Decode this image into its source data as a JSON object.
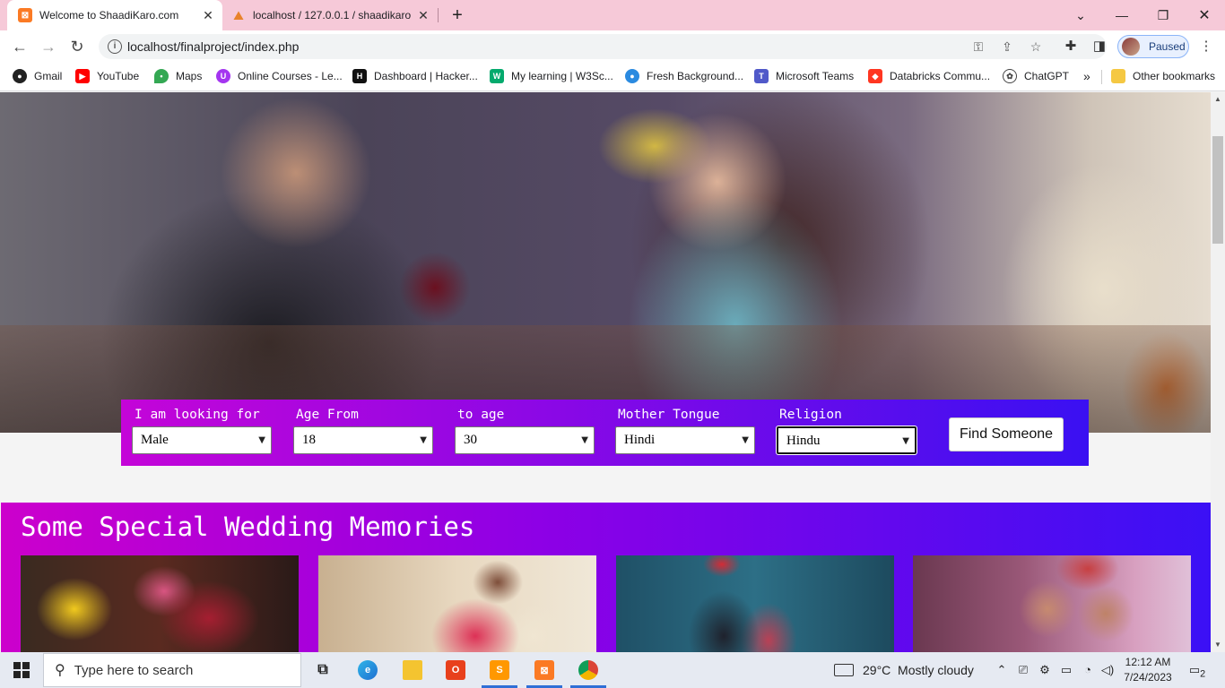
{
  "browser": {
    "tabs": [
      {
        "title": "Welcome to ShaadiKaro.com",
        "icon": "xampp-icon"
      },
      {
        "title": "localhost / 127.0.0.1 / shaadikaro",
        "icon": "phpmyadmin-icon"
      }
    ],
    "url": "localhost/finalproject/index.php",
    "profile_status": "Paused",
    "bookmarks": [
      "Gmail",
      "YouTube",
      "Maps",
      "Online Courses - Le...",
      "Dashboard | Hacker...",
      "My learning | W3Sc...",
      "Fresh Background...",
      "Microsoft Teams",
      "Databricks Commu...",
      "ChatGPT"
    ],
    "bookmarks_overflow": "»",
    "other_bookmarks": "Other bookmarks"
  },
  "search": {
    "looking_for": {
      "label": "I am looking for",
      "value": "Male"
    },
    "age_from": {
      "label": "Age From",
      "value": "18"
    },
    "to_age": {
      "label": "to age",
      "value": "30"
    },
    "mother_tongue": {
      "label": "Mother Tongue",
      "value": "Hindi"
    },
    "religion": {
      "label": "Religion",
      "value": "Hindu"
    },
    "button": "Find Someone"
  },
  "memories": {
    "title": "Some Special Wedding Memories"
  },
  "taskbar": {
    "search_placeholder": "Type here to search",
    "weather": "29°C  Mostly cloudy",
    "time": "12:12 AM",
    "date": "7/24/2023",
    "notification_count": "2"
  },
  "colors": {
    "tab_strip": "#f6c9d8",
    "search_gradient": [
      "#c405d8",
      "#3a10f2"
    ],
    "memories_gradient": [
      "#cc00cc",
      "#3b10f5"
    ]
  }
}
